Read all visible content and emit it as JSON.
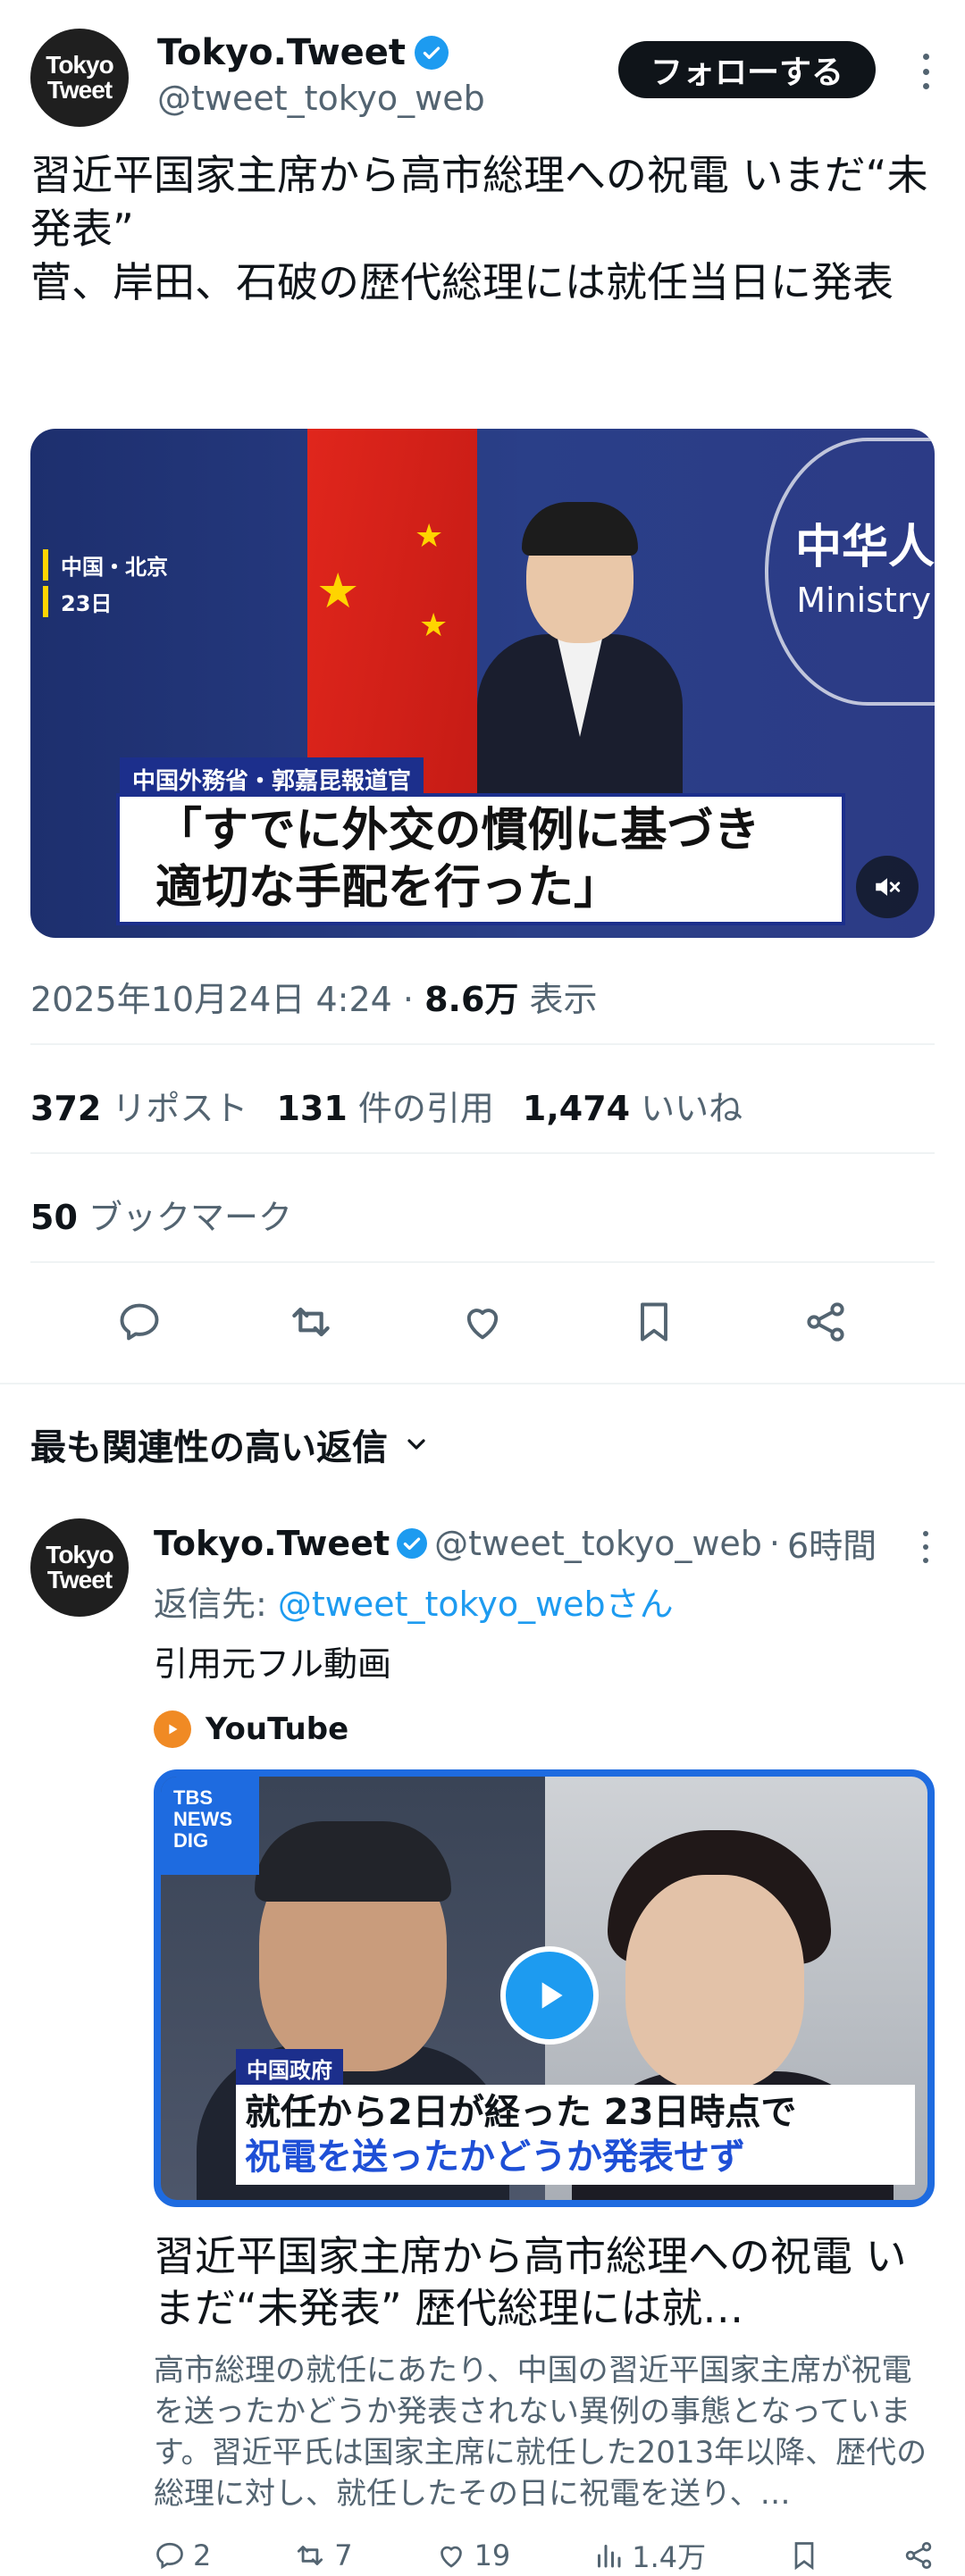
{
  "tweet": {
    "author_name": "Tokyo.Tweet",
    "author_handle": "@tweet_tokyo_web",
    "avatar_text_1": "Tokyo",
    "avatar_text_2": "Tweet",
    "follow_label": "フォローする",
    "text": "習近平国家主席から高市総理への祝電 いまだ“未発表”\n菅、岸田、石破の歴代総理には就任当日に発表",
    "media": {
      "location_line1": "中国・北京",
      "location_line2": "23日",
      "ministry_cn": "中华人",
      "ministry_en": "Ministry",
      "caption_label": "中国外務省・郭嘉昆報道官",
      "caption_text": "「すでに外交の慣例に基づき\n 適切な手配を行った」"
    },
    "timestamp": "2025年10月24日 4:24",
    "separator": "·",
    "views_count": "8.6万",
    "views_label": "表示",
    "reposts_count": "372",
    "reposts_label": "リポスト",
    "quotes_count": "131",
    "quotes_label": "件の引用",
    "likes_count": "1,474",
    "likes_label": "いいね",
    "bookmarks_count": "50",
    "bookmarks_label": "ブックマーク"
  },
  "replies_sort_label": "最も関連性の高い返信",
  "reply": {
    "author_name": "Tokyo.Tweet",
    "author_handle": "@tweet_tokyo_web",
    "dot": "·",
    "time": "6時間",
    "reply_to_prefix": "返信先: ",
    "reply_to_handle": "@tweet_tokyo_webさん",
    "text": "引用元フル動画",
    "source": "YouTube",
    "card": {
      "logo_line1": "TBS",
      "logo_line2": "NEWS",
      "logo_line3": "DIG",
      "tag": "中国政府",
      "caption_line1": "就任から2日が経った 23日時点で",
      "caption_line2": "祝電を送ったかどうか発表せず",
      "title": "習近平国家主席から高市総理への祝電 いまだ“未発表” 歴代総理には就…",
      "description": "高市総理の就任にあたり、中国の習近平国家主席が祝電を送ったかどうか発表されない異例の事態となっています。習近平氏は国家主席に就任した2013年以降、歴代の総理に対し、就任したその日に祝電を送り、…"
    },
    "replies_count": "2",
    "reposts_count": "7",
    "likes_count": "19",
    "views_count": "1.4万"
  },
  "colors": {
    "accent": "#1d9bf0",
    "text_primary": "#0f1419",
    "text_secondary": "#536471",
    "divider": "#eff3f4"
  },
  "icons": [
    "verified-badge-icon",
    "more-icon",
    "mute-icon",
    "reply-icon",
    "repost-icon",
    "like-icon",
    "bookmark-icon",
    "share-icon",
    "chevron-down-icon",
    "youtube-icon",
    "play-icon",
    "views-icon"
  ]
}
